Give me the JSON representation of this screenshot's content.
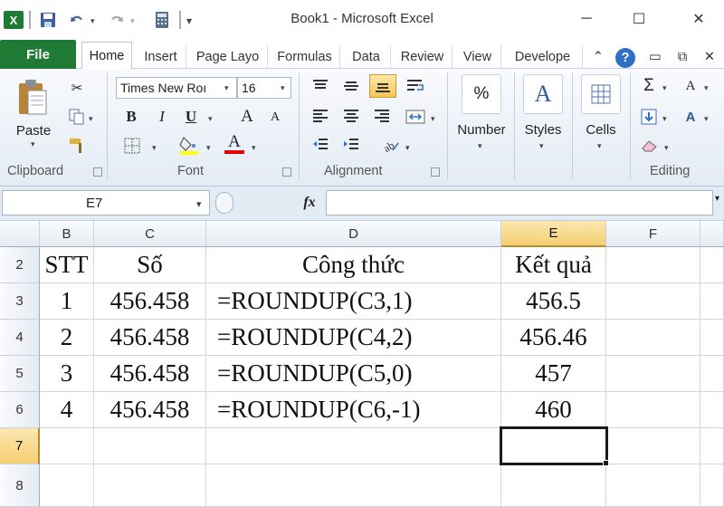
{
  "window": {
    "title": "Book1  -  Microsoft Excel",
    "minimize": "─",
    "restore": "☐",
    "close": "✕"
  },
  "quick_access": {
    "app_icon": "X",
    "save": "💾",
    "undo": "↶",
    "redo": "↷",
    "calc": "▦"
  },
  "tabs": [
    "File",
    "Home",
    "Insert",
    "Page Layo",
    "Formulas",
    "Data",
    "Review",
    "View",
    "Develope"
  ],
  "tab_extras": {
    "up": "⌃",
    "help": "?",
    "min": "▭",
    "restore": "⧉",
    "close": "✕"
  },
  "ribbon": {
    "clipboard": {
      "label": "Clipboard",
      "paste_label": "Paste"
    },
    "font": {
      "label": "Font",
      "font_name": "Times New Roı",
      "font_size": "16",
      "bold": "B",
      "italic": "I",
      "underline": "U",
      "grow": "A",
      "shrink": "A",
      "font_color_glyph": "A"
    },
    "alignment": {
      "label": "Alignment"
    },
    "number": {
      "label": "Number",
      "glyph": "%"
    },
    "styles": {
      "label": "Styles",
      "glyph": "A"
    },
    "cells": {
      "label": "Cells"
    },
    "editing": {
      "label": "Editing",
      "sum": "Σ",
      "sort": "A",
      "find": "A"
    }
  },
  "formula_bar": {
    "name_box": "E7",
    "fx": "fx",
    "formula": ""
  },
  "sheet": {
    "columns": [
      "B",
      "C",
      "D",
      "E",
      "F"
    ],
    "selected_column": "E",
    "selected_row": "7",
    "selected_cell": "E7",
    "rows": [
      {
        "num": "2",
        "cells": [
          "STT",
          "Số",
          "Công thức",
          "Kết quả",
          ""
        ]
      },
      {
        "num": "3",
        "cells": [
          "1",
          "456.458",
          "=ROUNDUP(C3,1)",
          "456.5",
          ""
        ]
      },
      {
        "num": "4",
        "cells": [
          "2",
          "456.458",
          "=ROUNDUP(C4,2)",
          "456.46",
          ""
        ]
      },
      {
        "num": "5",
        "cells": [
          "3",
          "456.458",
          "=ROUNDUP(C5,0)",
          "457",
          ""
        ]
      },
      {
        "num": "6",
        "cells": [
          "4",
          "456.458",
          "=ROUNDUP(C6,-1)",
          "460",
          ""
        ]
      },
      {
        "num": "7",
        "cells": [
          "",
          "",
          "",
          "",
          ""
        ]
      },
      {
        "num": "8",
        "cells": [
          "",
          "",
          "",
          "",
          ""
        ]
      }
    ]
  },
  "colors": {
    "file_tab": "#1f7a33",
    "selection_border": "#1a1a1a",
    "header_highlight": "#f5cf72"
  }
}
